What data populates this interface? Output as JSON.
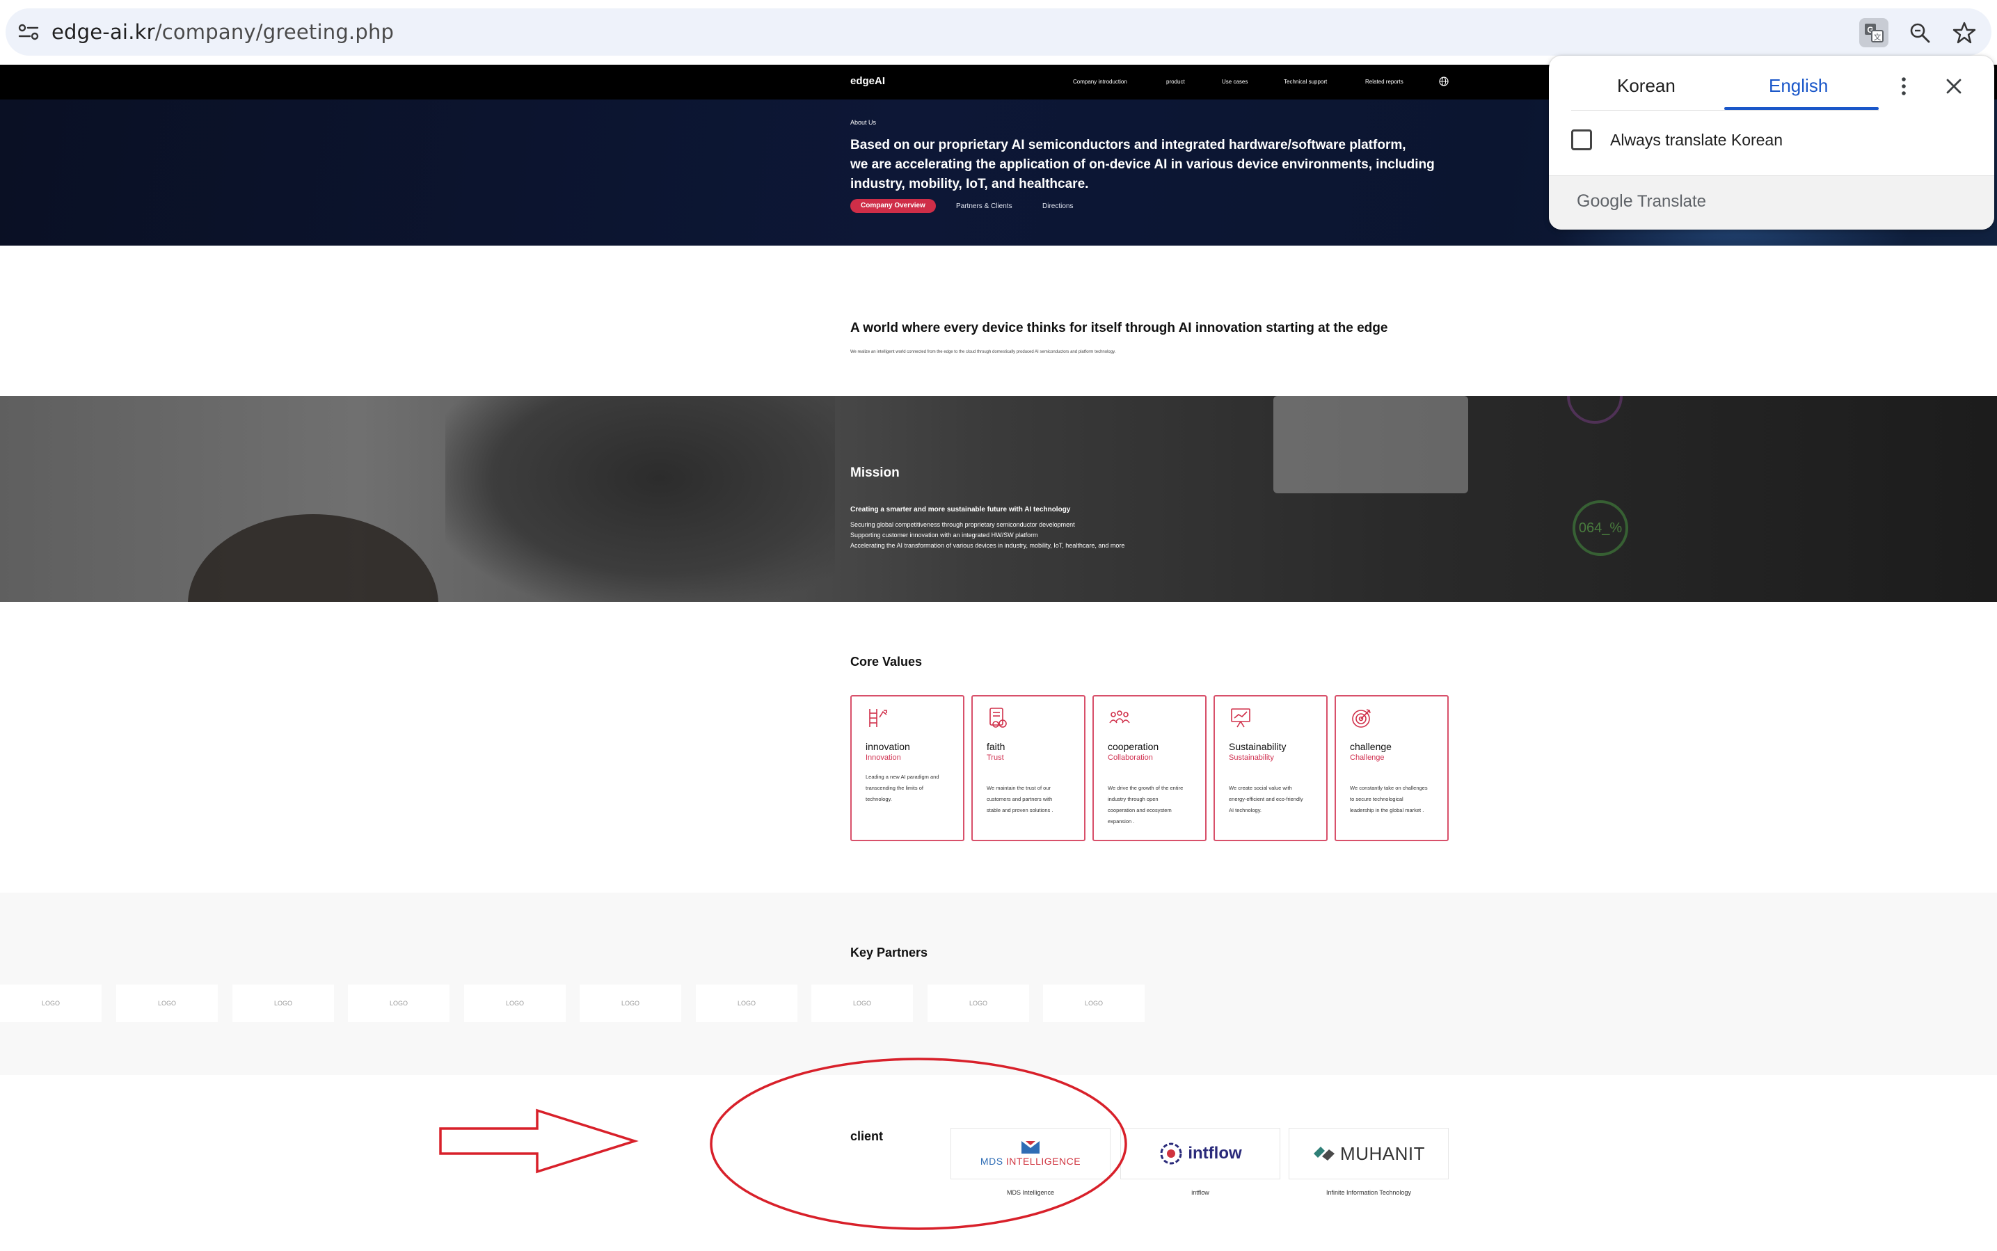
{
  "browser": {
    "url_host": "edge-ai.kr",
    "url_path": "/company/greeting.php",
    "icons": [
      "tune-icon",
      "translate-icon",
      "zoom-icon",
      "star-icon"
    ]
  },
  "nav": {
    "logo": "edgeAI",
    "items": [
      "Company introduction",
      "product",
      "Use cases",
      "Technical support",
      "Related reports"
    ]
  },
  "hero": {
    "label": "About Us",
    "line1": "Based on our proprietary AI semiconductors and integrated hardware/software platform,",
    "line2": "we are accelerating the application of on-device AI in various device environments, including",
    "line3": "industry, mobility, IoT, and healthcare.",
    "pill": "Company Overview",
    "subnav": [
      "Partners & Clients",
      "Directions"
    ]
  },
  "vision": {
    "title": "A world where every device thinks for itself through AI innovation starting at the edge",
    "subtitle": "We realize an intelligent world connected from the edge to the cloud through domestically produced AI semiconductors and platform technology."
  },
  "mission": {
    "title": "Mission",
    "lead": "Creating a smarter and more sustainable future with AI technology",
    "lines": [
      "Securing global competitiveness through proprietary semiconductor development",
      "Supporting customer innovation with an integrated HW/SW platform",
      "Accelerating the AI transformation of various devices in industry, mobility, IoT, healthcare, and more"
    ],
    "gauge": "064_%"
  },
  "core_values": {
    "title": "Core Values",
    "cards": [
      {
        "name": "innovation",
        "kr": "Innovation",
        "desc": [
          "Leading a new AI paradigm and",
          "transcending the limits of",
          "technology."
        ]
      },
      {
        "name": "faith",
        "kr": "Trust",
        "desc": [
          "We maintain the trust of our",
          "customers and partners with",
          "stable and proven solutions ."
        ]
      },
      {
        "name": "cooperation",
        "kr": "Collaboration",
        "desc": [
          "We drive the growth of the entire",
          "industry through open",
          "cooperation and ecosystem",
          "expansion ."
        ]
      },
      {
        "name": "Sustainability",
        "kr": "Sustainability",
        "desc": [
          "We create social value with",
          "energy-efficient and eco-friendly",
          "AI technology."
        ]
      },
      {
        "name": "challenge",
        "kr": "Challenge",
        "desc": [
          "We constantly take on challenges",
          "to secure technological",
          "leadership in the global market ."
        ]
      }
    ]
  },
  "partners": {
    "title": "Key Partners",
    "logos": [
      "LOGO",
      "LOGO",
      "LOGO",
      "LOGO",
      "LOGO",
      "LOGO",
      "LOGO",
      "LOGO",
      "LOGO",
      "LOGO"
    ]
  },
  "client": {
    "title": "client",
    "items": [
      {
        "logo_a": "MDS ",
        "logo_b": "INTELLIGENCE",
        "caption": "MDS Intelligence"
      },
      {
        "logo": "intflow",
        "caption": "intflow"
      },
      {
        "logo": "MUHANIT",
        "caption": "Infinite Information Technology"
      }
    ]
  },
  "translate_popup": {
    "tab_source": "Korean",
    "tab_target": "English",
    "always_label": "Always translate Korean",
    "footer_google": "Google",
    "footer_translate": " Translate"
  },
  "colors": {
    "accent": "#cf2e48",
    "card_border": "#d8506a",
    "annotation": "#d8202a",
    "translate_blue": "#1a57c9"
  }
}
